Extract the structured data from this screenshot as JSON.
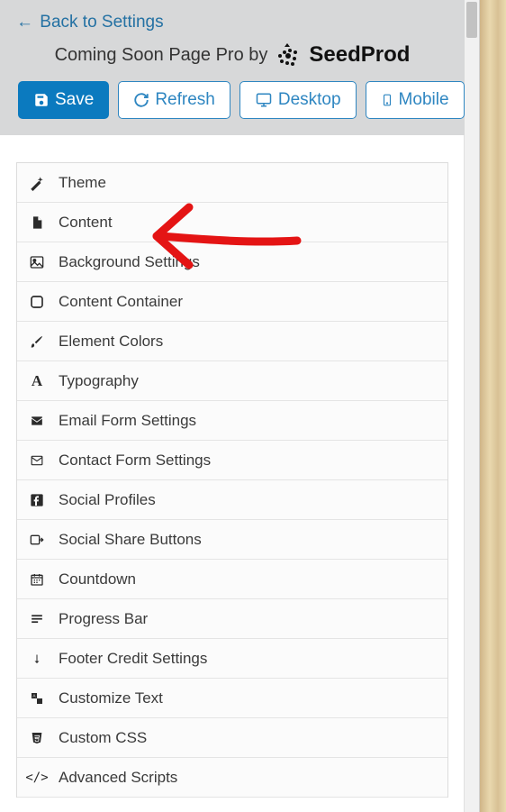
{
  "back_link": "Back to Settings",
  "brand_prefix": "Coming Soon Page Pro by",
  "brand_name": "SeedProd",
  "buttons": {
    "save": "Save",
    "refresh": "Refresh",
    "desktop": "Desktop",
    "mobile": "Mobile"
  },
  "menu": {
    "theme": "Theme",
    "content": "Content",
    "background": "Background Settings",
    "container": "Content Container",
    "colors": "Element Colors",
    "typography": "Typography",
    "email_form": "Email Form Settings",
    "contact_form": "Contact Form Settings",
    "social_profiles": "Social Profiles",
    "social_share": "Social Share Buttons",
    "countdown": "Countdown",
    "progress": "Progress Bar",
    "footer_credit": "Footer Credit Settings",
    "customize_text": "Customize Text",
    "custom_css": "Custom CSS",
    "advanced_scripts": "Advanced Scripts"
  }
}
